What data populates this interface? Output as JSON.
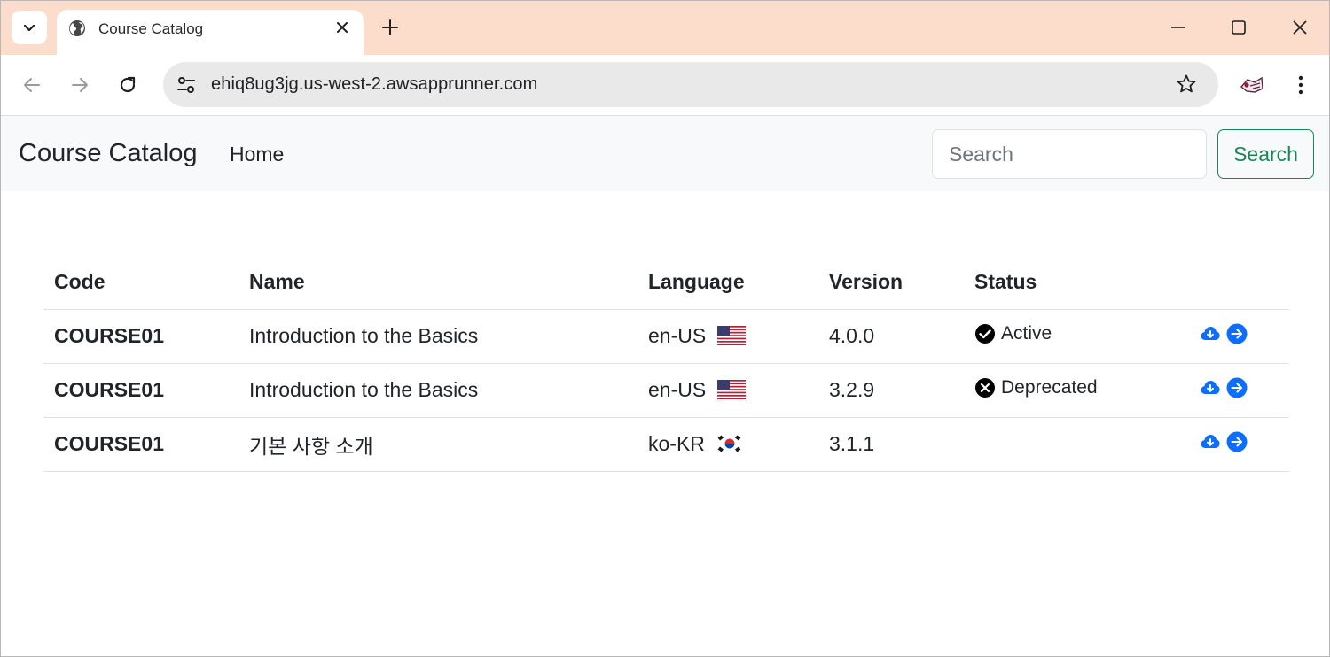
{
  "browser": {
    "tab_title": "Course Catalog",
    "url": "ehiq8ug3jg.us-west-2.awsapprunner.com",
    "accent_color": "#fcdcca"
  },
  "navbar": {
    "brand": "Course Catalog",
    "home_link": "Home",
    "search_placeholder": "Search",
    "search_button": "Search",
    "search_button_color": "#198754"
  },
  "table": {
    "headers": [
      "Code",
      "Name",
      "Language",
      "Version",
      "Status"
    ],
    "rows": [
      {
        "code": "COURSE01",
        "name": "Introduction to the Basics",
        "language": "en-US",
        "flag": "us-flag",
        "version": "4.0.0",
        "status": "Active",
        "status_icon": "check-circle-icon"
      },
      {
        "code": "COURSE01",
        "name": "Introduction to the Basics",
        "language": "en-US",
        "flag": "us-flag",
        "version": "3.2.9",
        "status": "Deprecated",
        "status_icon": "x-circle-icon"
      },
      {
        "code": "COURSE01",
        "name": "기본 사항 소개",
        "language": "ko-KR",
        "flag": "kr-flag",
        "version": "3.1.1",
        "status": "",
        "status_icon": ""
      }
    ],
    "action_icons": [
      "cloud-download-icon",
      "arrow-right-circle-icon"
    ],
    "action_color": "#0d6efd"
  }
}
